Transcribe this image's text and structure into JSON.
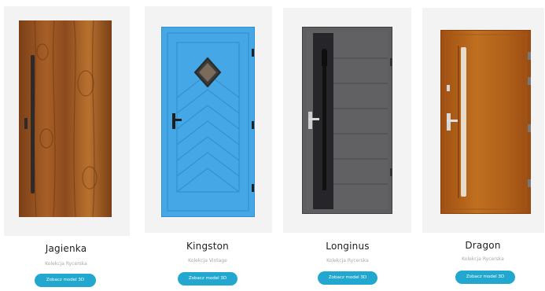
{
  "products": [
    {
      "name": "Jagienka",
      "collection": "Kolekcja Rycerska",
      "button": "Zobacz model 3D",
      "door": "wood-plank-door"
    },
    {
      "name": "Kingston",
      "collection": "Kolekcja Vintage",
      "button": "Zobacz model 3D",
      "door": "blue-chevron-door"
    },
    {
      "name": "Longinus",
      "collection": "Kolekcja Rycerska",
      "button": "Zobacz model 3D",
      "door": "graphite-door"
    },
    {
      "name": "Dragon",
      "collection": "Kolekcja Rycerska",
      "button": "Zobacz model 3D",
      "door": "golden-oak-door"
    }
  ],
  "colors": {
    "accent": "#22a8cf",
    "panel": "#f3f3f3",
    "wood": "#9a5420",
    "blue": "#45a7e6",
    "graphite": "#5e5e61",
    "oak": "#b86418"
  }
}
